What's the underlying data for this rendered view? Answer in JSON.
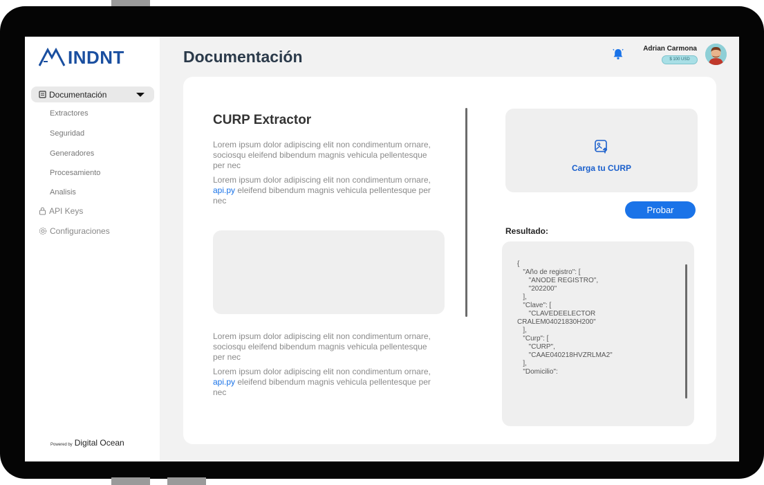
{
  "app": {
    "logo_text": "INDNT",
    "page_title": "Documentación"
  },
  "sidebar": {
    "active": {
      "label": "Documentación"
    },
    "sub_items": [
      "Extractores",
      "Seguridad",
      "Generadores",
      "Procesamiento",
      "Analisis"
    ],
    "items": [
      {
        "label": "API Keys",
        "icon": "lock-icon"
      },
      {
        "label": "Configuraciones",
        "icon": "gear-icon"
      }
    ],
    "powered_prefix": "Powered by",
    "powered_name": "Digital Ocean"
  },
  "header": {
    "user_name": "Adrian Carmona",
    "balance": "$ 100 USD",
    "bell_icon": "bell-icon",
    "accent": "#1a73e8"
  },
  "doc": {
    "title": "CURP Extractor",
    "para1": "Lorem ipsum dolor adipiscing elit non condimentum ornare, sociosqu eleifend bibendum magnis vehicula pellentesque per nec",
    "para2_before": "Lorem ipsum dolor adipiscing elit non condimentum ornare, ",
    "para2_link": "api.py",
    "para2_after": " eleifend bibendum magnis vehicula pellentesque per nec",
    "para3": "Lorem ipsum dolor adipiscing elit non condimentum ornare, sociosqu eleifend bibendum magnis vehicula pellentesque per nec",
    "para4_before": "Lorem ipsum dolor adipiscing elit non condimentum ornare, ",
    "para4_link": "api.py",
    "para4_after": " eleifend bibendum magnis vehicula pellentesque per nec"
  },
  "upload": {
    "label": "Carga tu CURP",
    "icon": "image-upload-icon"
  },
  "actions": {
    "test_button": "Probar"
  },
  "result": {
    "label": "Resultado:",
    "json_text": "{\n   \"Año de registro\": [\n      \"ANODE REGISTRO\",\n      \"202200\"\n   ],\n   \"Clave\": [\n      \"CLAVEDEELECTOR\nCRALEM04021830H200\"\n   ],\n   \"Curp\": [\n      \"CURP\",\n      \"CAAE040218HVZRLMA2\"\n   ],\n   \"Domicilio\":"
  }
}
